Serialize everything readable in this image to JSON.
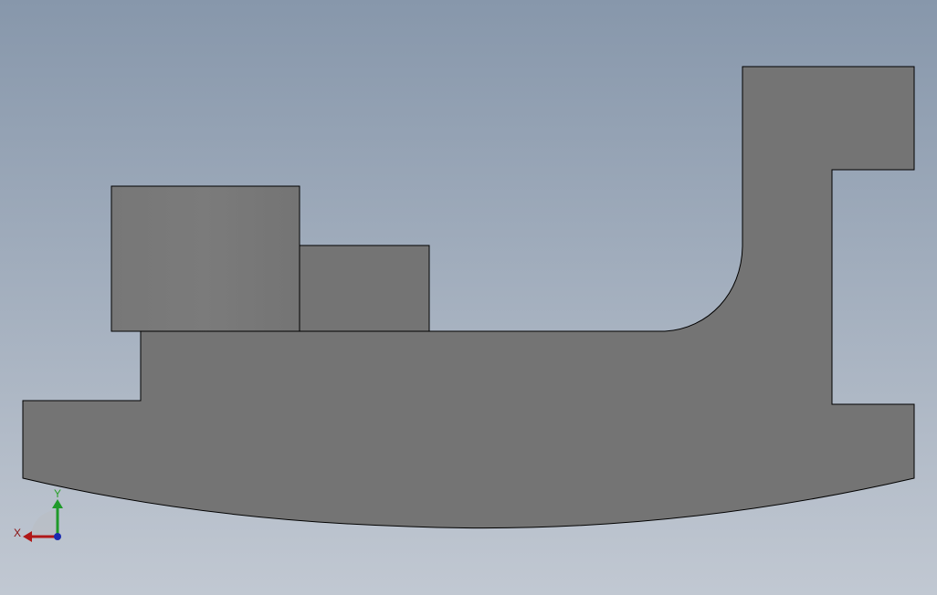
{
  "viewport": {
    "background_top": "#8797ab",
    "background_bottom": "#c1c8d2",
    "part_fill": "#747474",
    "part_fill_light": "#7a7a7a",
    "edge_color": "#000000"
  },
  "triad": {
    "x_label": "X",
    "y_label": "Y",
    "x_color": "#b01818",
    "y_color": "#1f9a2a",
    "z_color": "#1a2bb0",
    "label_color": "#8a1010",
    "y_label_color": "#2aa02a"
  }
}
